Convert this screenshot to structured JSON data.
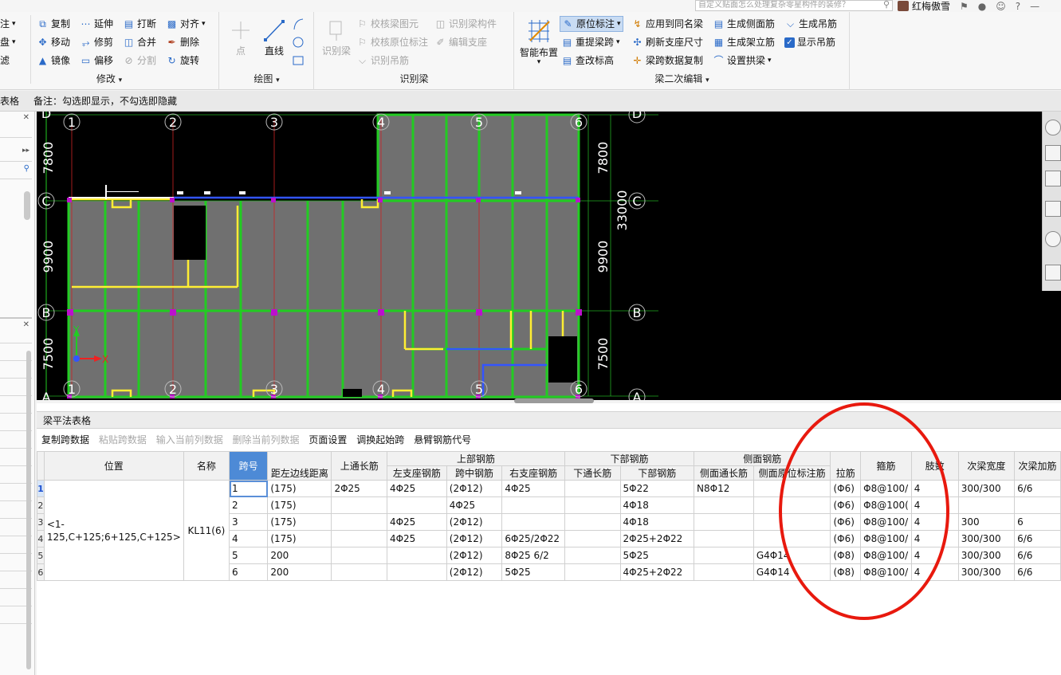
{
  "topbar": {
    "search_placeholder": "自定义贴面怎么处理复杂零星构件的装修？",
    "user_name": "红梅傲雪"
  },
  "ribbon": {
    "group_modify": {
      "title": "修改",
      "left_partial": [
        "注",
        "盘",
        "滤"
      ],
      "items": [
        "复制",
        "延伸",
        "打断",
        "对齐",
        "移动",
        "修剪",
        "合并",
        "删除",
        "镜像",
        "偏移",
        "分割",
        "旋转"
      ]
    },
    "group_draw": {
      "title": "绘图",
      "items": [
        "点",
        "直线"
      ]
    },
    "group_recognize": {
      "title": "识别梁",
      "items": [
        "识别梁",
        "校核梁图元",
        "识别梁构件",
        "校核原位标注",
        "编辑支座",
        "识别吊筋"
      ]
    },
    "group_edit": {
      "title": "梁二次编辑",
      "smart_layout": "智能布置",
      "items": [
        "原位标注",
        "应用到同名梁",
        "生成侧面筋",
        "生成吊筋",
        "重提梁跨",
        "刷新支座尺寸",
        "生成架立筋",
        "显示吊筋",
        "查改标高",
        "梁跨数据复制",
        "设置拱梁"
      ]
    }
  },
  "notebar": {
    "left_label": "表格",
    "note": "备注：勾选即显示，不勾选即隐藏"
  },
  "canvas": {
    "axis_numbers": [
      "1",
      "2",
      "3",
      "4",
      "5",
      "6"
    ],
    "axis_letters": [
      "D",
      "C",
      "B",
      "A"
    ],
    "dims_left": [
      "7800",
      "9900",
      "7500"
    ],
    "dims_right": [
      "7800",
      "9900",
      "7500"
    ],
    "total_dim": "33000",
    "ucs_y": "Y",
    "ucs_x": "X"
  },
  "tablepanel": {
    "title": "梁平法表格",
    "toolbar": [
      "复制跨数据",
      "粘贴跨数据",
      "输入当前列数据",
      "删除当前列数据",
      "页面设置",
      "调换起始跨",
      "悬臂钢筋代号"
    ],
    "toolbar_disabled": [
      false,
      true,
      true,
      true,
      false,
      false,
      false
    ],
    "headers": {
      "position": "位置",
      "name": "名称",
      "span": "跨号",
      "left_dist": "距左边线距离",
      "top_through": "上通长筋",
      "top_group": "上部钢筋",
      "left_support": "左支座钢筋",
      "mid_span": "跨中钢筋",
      "right_support": "右支座钢筋",
      "bottom_group": "下部钢筋",
      "bottom_through": "下通长筋",
      "bottom_bar": "下部钢筋",
      "side_group": "侧面钢筋",
      "side_through": "侧面通长筋",
      "side_in_place": "侧面原位标注筋",
      "tie": "拉筋",
      "stirrup": "箍筋",
      "legs": "肢数",
      "sec_width": "次梁宽度",
      "sec_add": "次梁加筋"
    },
    "position_text": "<1-125,C+125;6+125,C+125>",
    "name_text": "KL11(6)",
    "rows": [
      {
        "rn": "1",
        "span": "1",
        "left_dist": "(175)",
        "top_through": "2Φ25",
        "left_support": "4Φ25",
        "mid_span": "(2Φ12)",
        "right_support": "4Φ25",
        "bottom_through": "",
        "bottom_bar": "5Φ22",
        "side_through": "N8Φ12",
        "side_in_place": "",
        "tie": "(Φ6)",
        "stirrup": "Φ8@100/",
        "legs": "4",
        "sec_width": "300/300",
        "sec_add": "6/6"
      },
      {
        "rn": "2",
        "span": "2",
        "left_dist": "(175)",
        "top_through": "",
        "left_support": "",
        "mid_span": "4Φ25",
        "right_support": "",
        "bottom_through": "",
        "bottom_bar": "4Φ18",
        "side_through": "",
        "side_in_place": "",
        "tie": "(Φ6)",
        "stirrup": "Φ8@100(",
        "legs": "4",
        "sec_width": "",
        "sec_add": ""
      },
      {
        "rn": "3",
        "span": "3",
        "left_dist": "(175)",
        "top_through": "",
        "left_support": "4Φ25",
        "mid_span": "(2Φ12)",
        "right_support": "",
        "bottom_through": "",
        "bottom_bar": "4Φ18",
        "side_through": "",
        "side_in_place": "",
        "tie": "(Φ6)",
        "stirrup": "Φ8@100/",
        "legs": "4",
        "sec_width": "300",
        "sec_add": "6"
      },
      {
        "rn": "4",
        "span": "4",
        "left_dist": "(175)",
        "top_through": "",
        "left_support": "4Φ25",
        "mid_span": "(2Φ12)",
        "right_support": "6Φ25/2Φ22",
        "bottom_through": "",
        "bottom_bar": "2Φ25+2Φ22",
        "side_through": "",
        "side_in_place": "",
        "tie": "(Φ6)",
        "stirrup": "Φ8@100/",
        "legs": "4",
        "sec_width": "300/300",
        "sec_add": "6/6"
      },
      {
        "rn": "5",
        "span": "5",
        "left_dist": "200",
        "top_through": "",
        "left_support": "",
        "mid_span": "(2Φ12)",
        "right_support": "8Φ25 6/2",
        "bottom_through": "",
        "bottom_bar": "5Φ25",
        "side_through": "",
        "side_in_place": "G4Φ14",
        "tie": "(Φ8)",
        "stirrup": "Φ8@100/",
        "legs": "4",
        "sec_width": "300/300",
        "sec_add": "6/6"
      },
      {
        "rn": "6",
        "span": "6",
        "left_dist": "200",
        "top_through": "",
        "left_support": "",
        "mid_span": "(2Φ12)",
        "right_support": "5Φ25",
        "bottom_through": "",
        "bottom_bar": "4Φ25+2Φ22",
        "side_through": "",
        "side_in_place": "G4Φ14",
        "tie": "(Φ8)",
        "stirrup": "Φ8@100/",
        "legs": "4",
        "sec_width": "300/300",
        "sec_add": "6/6"
      }
    ]
  },
  "colors": {
    "beam_green": "#22cc22",
    "beam_yellow": "#ffee33",
    "beam_blue": "#3355ff",
    "column_magenta": "#bb11cc",
    "annotation_red": "#e8190e",
    "selected_blue": "#4d8ad6"
  }
}
